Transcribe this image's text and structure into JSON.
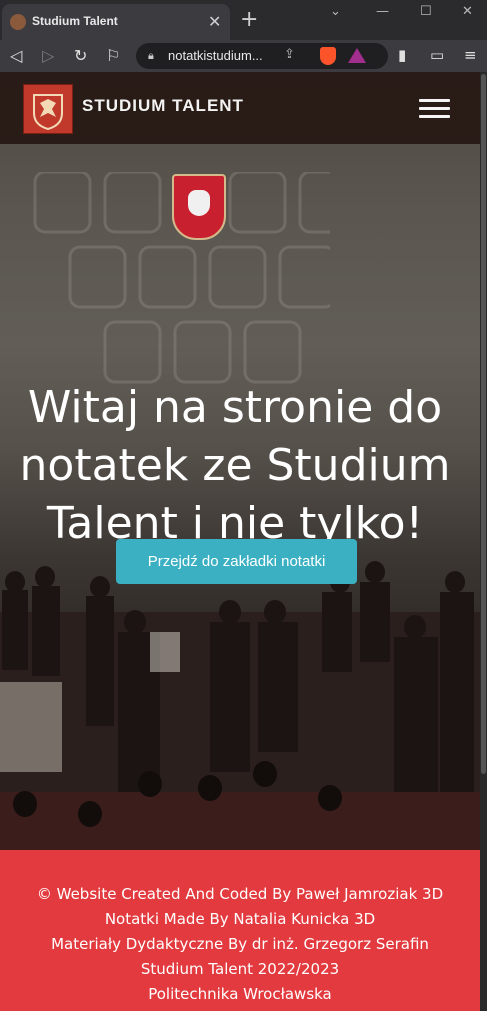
{
  "browser": {
    "tab_title": "Studium Talent",
    "url": "notatkistudium...",
    "window_controls": {
      "minimize": "—",
      "maximize": "☐",
      "close": "✕"
    }
  },
  "site": {
    "logo_text": "STUDIUM TALENT",
    "hero_title": "Witaj na stronie do notatek ze Studium Talent i nie tylko!",
    "cta_label": "Przejdź do zakładki notatki",
    "footer": {
      "line1": "© Website Created And Coded By Paweł Jamroziak 3D",
      "line2": "Notatki Made By Natalia Kunicka 3D",
      "line3": "Materiały Dydaktyczne By dr inż. Grzegorz Serafin",
      "line4": "Studium Talent 2022/2023",
      "line5": "Politechnika Wrocławska"
    }
  },
  "colors": {
    "footer_bg": "#e23a3e",
    "cta_bg": "#3bb0c2",
    "logo_red": "#c0392b"
  }
}
